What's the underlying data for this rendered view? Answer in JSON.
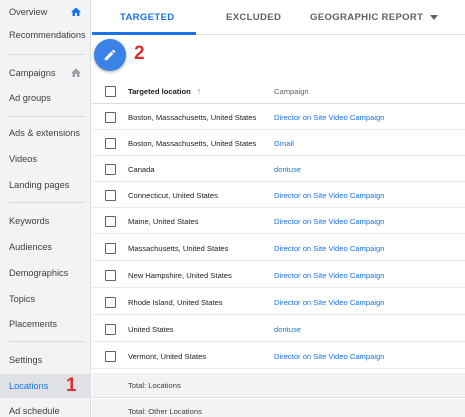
{
  "sidebar": {
    "items": [
      {
        "label": "Overview",
        "home_icon": true
      },
      {
        "label": "Recommendations"
      },
      {
        "label": "Campaigns",
        "home_icon": true
      },
      {
        "label": "Ad groups"
      },
      {
        "label": "Ads & extensions"
      },
      {
        "label": "Videos"
      },
      {
        "label": "Landing pages"
      },
      {
        "label": "Keywords"
      },
      {
        "label": "Audiences"
      },
      {
        "label": "Demographics"
      },
      {
        "label": "Topics"
      },
      {
        "label": "Placements"
      },
      {
        "label": "Settings"
      },
      {
        "label": "Locations",
        "active": true
      },
      {
        "label": "Ad schedule"
      }
    ],
    "annotation": "1"
  },
  "tabs": {
    "targeted": "TARGETED",
    "excluded": "EXCLUDED",
    "geographic_report": "GEOGRAPHIC REPORT"
  },
  "fab_annotation": "2",
  "table": {
    "headers": {
      "location": "Targeted location",
      "campaign": "Campaign"
    },
    "rows": [
      {
        "location": "Boston, Massachusetts, United States",
        "campaign": "Director on Site Video Campaign"
      },
      {
        "location": "Boston, Massachusetts, United States",
        "campaign": "Gmail"
      },
      {
        "location": "Canada",
        "campaign": "dontuse"
      },
      {
        "location": "Connecticut, United States",
        "campaign": "Director on Site Video Campaign"
      },
      {
        "location": "Maine, United States",
        "campaign": "Director on Site Video Campaign"
      },
      {
        "location": "Massachusetts, United States",
        "campaign": "Director on Site Video Campaign"
      },
      {
        "location": "New Hampshire, United States",
        "campaign": "Director on Site Video Campaign"
      },
      {
        "location": "Rhode Island, United States",
        "campaign": "Director on Site Video Campaign"
      },
      {
        "location": "United States",
        "campaign": "dontuse"
      },
      {
        "location": "Vermont, United States",
        "campaign": "Director on Site Video Campaign"
      }
    ],
    "totals": [
      "Total: Locations",
      "Total: Other Locations"
    ]
  },
  "colors": {
    "accent": "#1a73e8",
    "annotation": "#d9302c",
    "fab": "#3b82e6"
  }
}
